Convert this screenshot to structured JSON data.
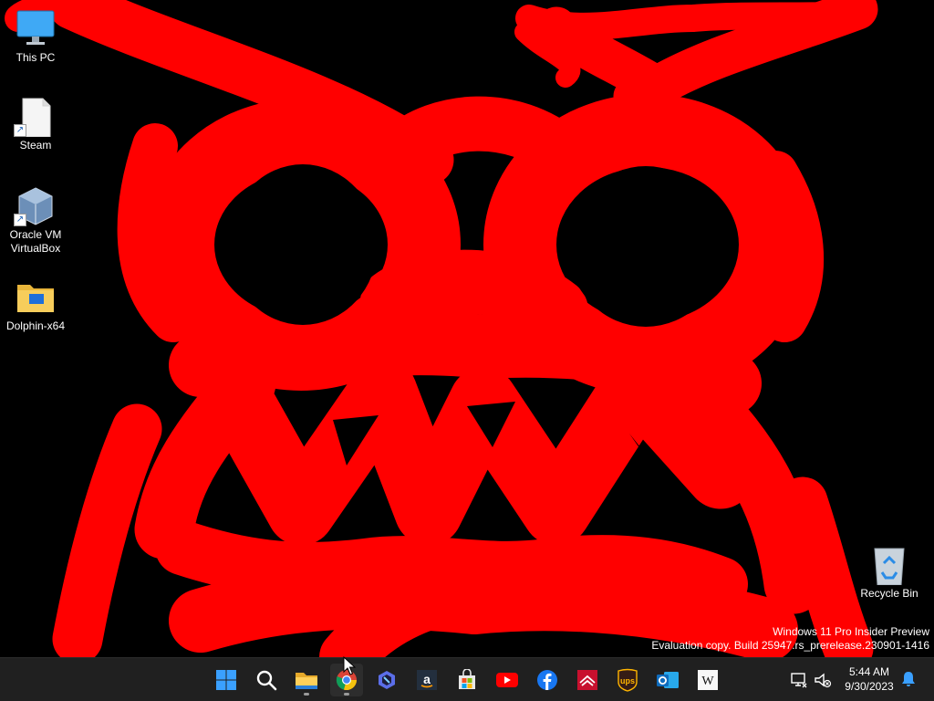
{
  "desktop": {
    "icons": [
      {
        "label": "This PC",
        "icon": "monitor-icon"
      },
      {
        "label": "Steam",
        "icon": "file-shortcut-icon"
      },
      {
        "label": "Oracle VM\nVirtualBox",
        "icon": "virtualbox-icon"
      },
      {
        "label": "Dolphin-x64",
        "icon": "folder-icon"
      },
      {
        "label": "Recycle Bin",
        "icon": "recycle-bin-icon"
      }
    ]
  },
  "watermark": {
    "line1": "Windows 11 Pro Insider Preview",
    "line2": "Evaluation copy. Build 25947.rs_prerelease.230901-1416"
  },
  "taskbar": {
    "apps": [
      "start-icon",
      "search-icon",
      "file-explorer-icon",
      "chrome-icon",
      "copilot-icon",
      "amazon-icon",
      "microsoft-store-icon",
      "youtube-icon",
      "facebook-icon",
      "bank-of-america-icon",
      "ups-icon",
      "outlook-icon",
      "wikipedia-icon"
    ],
    "wikipedia_letter": "W",
    "ups_text": "ups",
    "amazon_letter": "a"
  },
  "tray": {
    "time": "5:44 AM",
    "date": "9/30/2023"
  },
  "colors": {
    "wallpaper_bg": "#000000",
    "scribble": "#ff0000",
    "taskbar": "#202020"
  }
}
